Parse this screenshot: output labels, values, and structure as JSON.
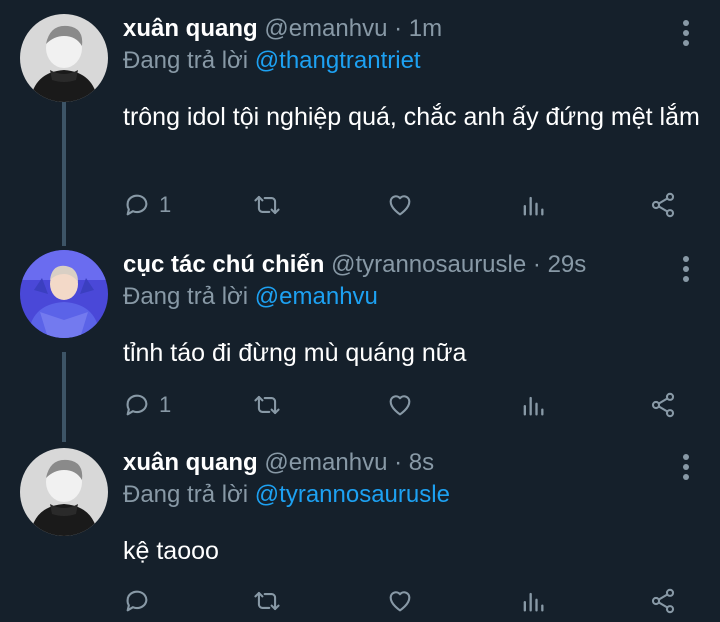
{
  "tweets": [
    {
      "name": "xuân quang",
      "handle": "@emanhvu",
      "dot": "·",
      "time": "1m",
      "reply_prefix": "Đang trả lời",
      "reply_to": "@thangtrantriet",
      "text": "trông idol tội nghiệp quá, chắc anh ấy đứng mệt lắm",
      "reply_count": "1"
    },
    {
      "name": "cục tác chú chiến",
      "handle": "@tyrannosaurusle",
      "dot": "·",
      "time": "29s",
      "reply_prefix": "Đang trả lời",
      "reply_to": "@emanhvu",
      "text": "tỉnh táo đi đừng mù quáng nữa",
      "reply_count": "1"
    },
    {
      "name": "xuân quang",
      "handle": "@emanhvu",
      "dot": "·",
      "time": "8s",
      "reply_prefix": "Đang trả lời",
      "reply_to": "@tyrannosaurusle",
      "text": "kệ taooo",
      "reply_count": ""
    }
  ],
  "icons": {
    "reply": "reply-icon",
    "retweet": "retweet-icon",
    "like": "heart-icon",
    "analytics": "analytics-icon",
    "share": "share-icon",
    "more": "more-options-icon"
  },
  "colors": {
    "background": "#15202b",
    "secondary_text": "#8899a6",
    "mention": "#1da1f2",
    "thread_line": "#3d5466"
  }
}
